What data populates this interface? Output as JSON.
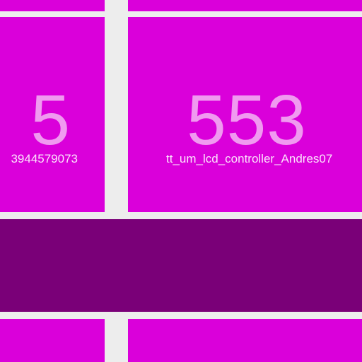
{
  "tiles": [
    {
      "number": "5",
      "label": "3944579073"
    },
    {
      "number": "553",
      "label": "tt_um_lcd_controller_Andres07"
    }
  ],
  "colors": {
    "background": "#EDEDED",
    "tile": "#DA00DA",
    "tile_dark": "#7A0078",
    "number_text": "#F09AF0",
    "label_text": "#FCE3FC"
  }
}
